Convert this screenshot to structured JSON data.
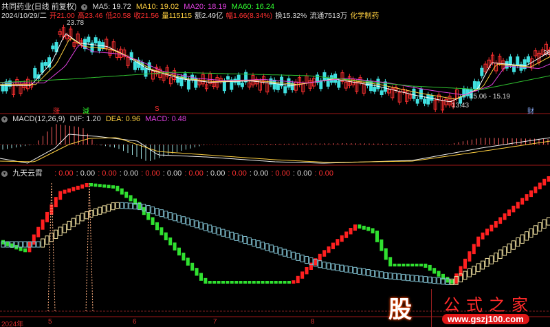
{
  "main": {
    "title": "共同药业(日线 前复权)",
    "ma5": "MA5: 19.72",
    "ma10": "MA10: 19.02",
    "ma20": "MA20: 18.19",
    "ma60": "MA60: 16.24",
    "date": "2024/10/29/二",
    "open": "开21.00",
    "high": "高23.46",
    "low": "低20.58",
    "close": "收21.56",
    "vol": "量115115",
    "amount": "额2.49亿",
    "change": "幅1.66(8.34%)",
    "turnover": "换15.32%",
    "float": "流通7513万",
    "sector": "化学制药",
    "high_mark": "23.78",
    "low_mark": "13.43",
    "range_mark": "15.06 - 15.19",
    "right_mark": "20",
    "signals": [
      "涨",
      "減",
      "S",
      "财"
    ]
  },
  "macd": {
    "title": "MACD(12,26,9)",
    "dif": "DIF: 1.20",
    "dea": "DEA: 0.96",
    "macd": "MACD: 0.48"
  },
  "cloud": {
    "title": "九天云霄",
    "values": [
      ": 0.00",
      ": 0.00",
      ": 0.00",
      ": 0.00",
      ": 0.00",
      ": 0.00",
      ": 0.00",
      ": 0.00",
      ": 0.00",
      ": 0.00",
      ": 0.00",
      ": 0.00",
      ": 0.00"
    ]
  },
  "axis": {
    "year": "2024年",
    "months": [
      "5",
      "6",
      "7",
      "8"
    ]
  },
  "watermark": {
    "char": "股",
    "name": "公式之家",
    "url": "www.gszj100.com"
  },
  "colors": {
    "up": "#ff3030",
    "down": "#40e0e0",
    "ma5": "#ffffff",
    "ma10": "#ffd040",
    "ma20": "#e040e0",
    "ma60": "#30c030"
  }
}
